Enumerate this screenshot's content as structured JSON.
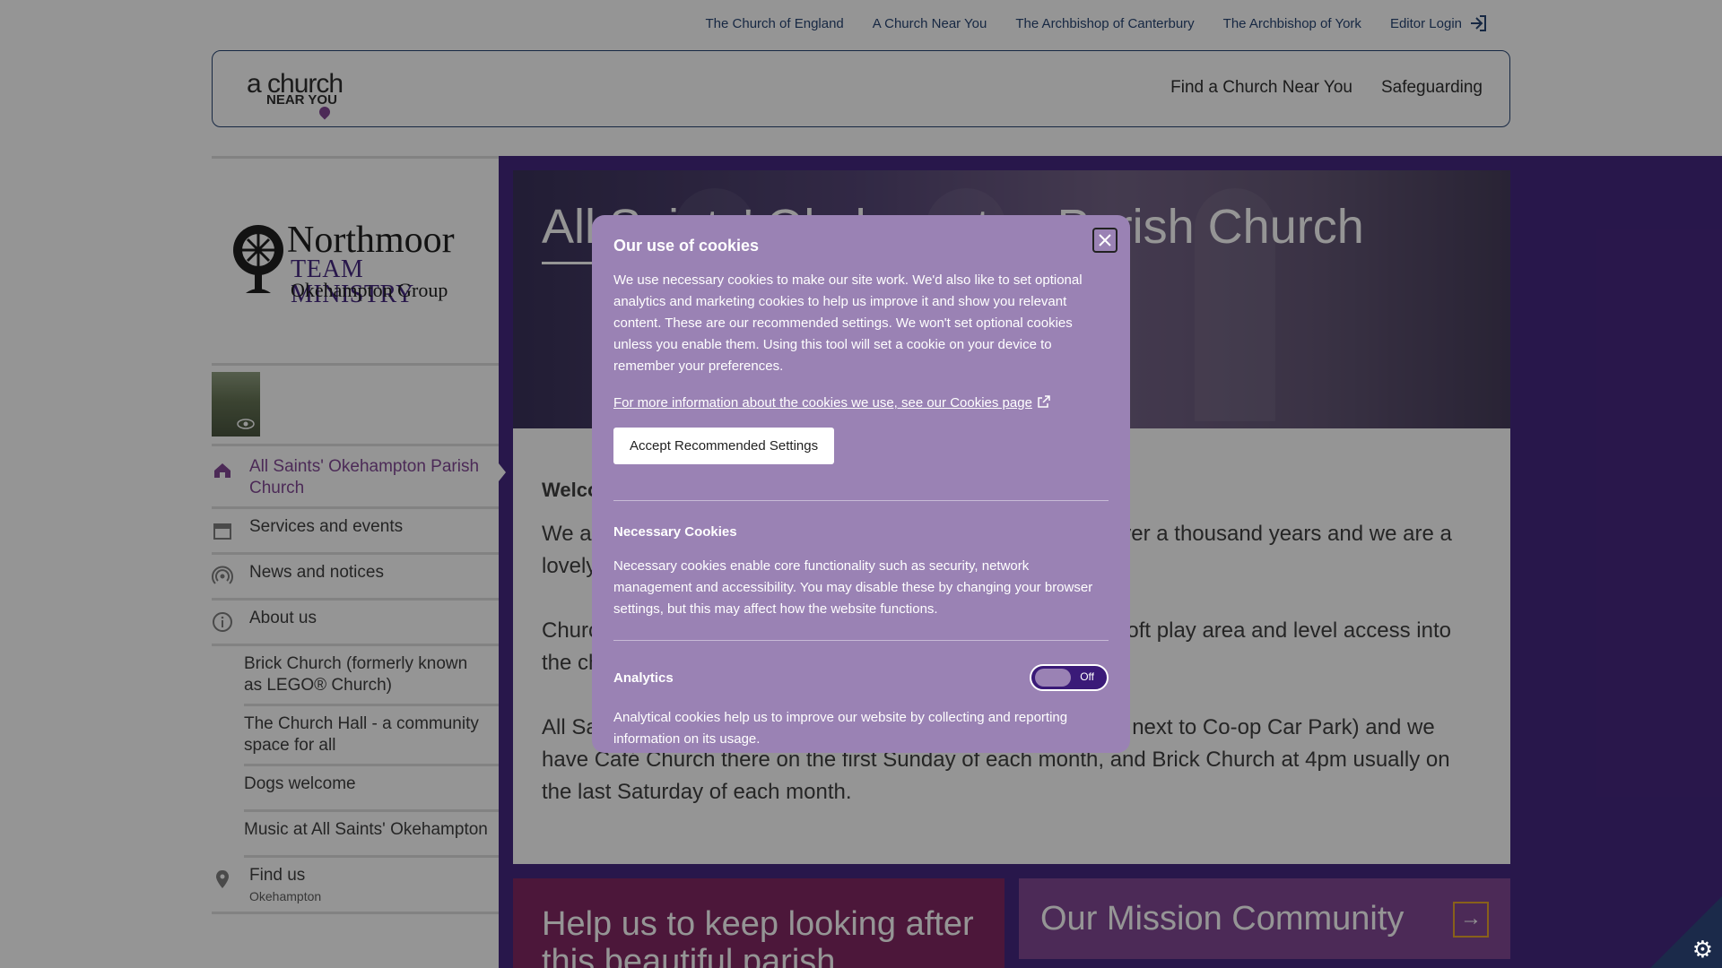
{
  "util_nav": {
    "links": [
      "The Church of England",
      "A Church Near You",
      "The Archbishop of Canterbury",
      "The Archbishop of York"
    ],
    "login": "Editor Login"
  },
  "header": {
    "logo_line1": "a church",
    "logo_line2": "NEAR YOU",
    "nav": [
      "Find a Church Near You",
      "Safeguarding"
    ]
  },
  "org": {
    "name_line1": "Northmoor",
    "name_line2": "TEAM MINISTRY",
    "name_line3": "Okehampton Group"
  },
  "sidebar": {
    "items": [
      {
        "label": "All Saints' Okehampton Parish Church",
        "icon": "home-icon",
        "active": true
      },
      {
        "label": "Services and events",
        "icon": "calendar-icon"
      },
      {
        "label": "News and notices",
        "icon": "broadcast-icon"
      },
      {
        "label": "About us",
        "icon": "info-icon"
      }
    ],
    "sub_items": [
      "Brick Church (formerly known as LEGO® Church)",
      "The Church Hall - a community space for all",
      "Dogs welcome",
      "Music at All Saints' Okehampton"
    ],
    "find_us": {
      "label": "Find us",
      "sub": "Okehampton",
      "icon": "map-pin-icon"
    }
  },
  "hero": {
    "title": "All Saints' Okehampton Parish Church"
  },
  "content": {
    "heading": "Welcome",
    "p1": "We are a church that has been serving our parishioners for over a thousand years and we are a lovely walk.",
    "p2": "Church services are also livestreamed.  There is a children's soft play area and level access into the church.",
    "p3": "All Saints' also has a hall, which is in the town (Market Street, next to Co-op Car Park) and we have Café Church there on the first Sunday of each month, and Brick Church at 4pm usually on the last Saturday of each month."
  },
  "cards": {
    "help": "Help us to keep looking after this beautiful parish",
    "mission": "Our Mission Community"
  },
  "cookie_modal": {
    "title": "Our use of cookies",
    "intro": "We use necessary cookies to make our site work. We'd also like to set optional analytics and marketing cookies to help us improve it and show you relevant content. These are our recommended settings. We won't set optional cookies unless you enable them. Using this tool will set a cookie on your device to remember your preferences.",
    "more_link": "For more information about the cookies we use, see our Cookies page",
    "accept_label": "Accept Recommended Settings",
    "necessary_title": "Necessary Cookies",
    "necessary_text": "Necessary cookies enable core functionality such as security, network management and accessibility. You may disable these by changing your browser settings, but this may affect how the website functions.",
    "analytics_title": "Analytics",
    "analytics_toggle": "Off",
    "analytics_text": "Analytical cookies help us to improve our website by collecting and reporting information on its usage."
  },
  "colors": {
    "accent_purple": "#7a3d8f",
    "deep_purple": "#3a1a78",
    "modal_bg": "#9a82b4",
    "link_navy": "#1b3a6b"
  }
}
